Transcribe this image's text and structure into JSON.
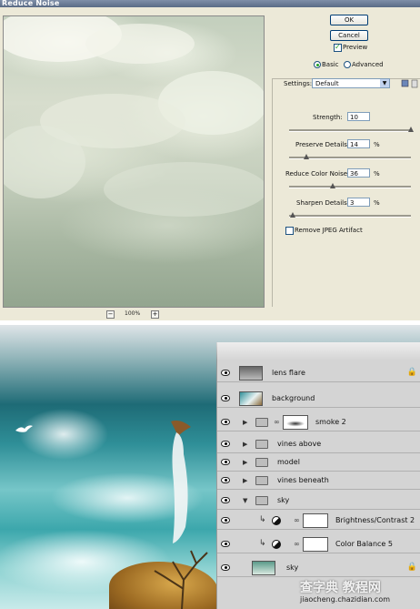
{
  "dialog": {
    "title": "Reduce Noise",
    "zoom": {
      "level": "100%",
      "minus": "−",
      "plus": "+"
    },
    "buttons": {
      "ok": "OK",
      "cancel": "Cancel"
    },
    "preview_checkbox": {
      "label": "Preview",
      "checked": true
    },
    "mode": {
      "basic": "Basic",
      "advanced": "Advanced",
      "selected": "Basic"
    },
    "settings": {
      "label": "Settings:",
      "value": "Default"
    },
    "fields": {
      "strength": {
        "label": "Strength:",
        "value": "10",
        "unit": "",
        "slider_fraction": 1.0
      },
      "preserve_details": {
        "label": "Preserve Details:",
        "value": "14",
        "unit": "%",
        "slider_fraction": 0.14
      },
      "reduce_color_noise": {
        "label": "Reduce Color Noise:",
        "value": "36",
        "unit": "%",
        "slider_fraction": 0.36
      },
      "sharpen_details": {
        "label": "Sharpen Details:",
        "value": "3",
        "unit": "%",
        "slider_fraction": 0.03
      }
    },
    "remove_jpeg": {
      "label": "Remove JPEG Artifact",
      "checked": false
    }
  },
  "layers": [
    {
      "name": "lens flare",
      "kind": "pixel",
      "visible": true
    },
    {
      "name": "background",
      "kind": "pixel",
      "visible": true
    },
    {
      "name": "smoke 2",
      "kind": "group-masked",
      "visible": true
    },
    {
      "name": "vines above",
      "kind": "group",
      "visible": true
    },
    {
      "name": "model",
      "kind": "group",
      "visible": true
    },
    {
      "name": "vines beneath",
      "kind": "group",
      "visible": true
    },
    {
      "name": "sky",
      "kind": "group-open",
      "visible": true
    },
    {
      "name": "Brightness/Contrast 2",
      "kind": "adjustment",
      "visible": true
    },
    {
      "name": "Color Balance 5",
      "kind": "adjustment",
      "visible": true
    },
    {
      "name": "sky",
      "kind": "pixel",
      "visible": true
    }
  ],
  "watermark": {
    "main": "查字典 教程网",
    "url": "jiaocheng.chazidian.com"
  },
  "colors": {
    "dialog_bg": "#ece9d8",
    "panel_bg": "#d4d4d4",
    "check_green": "#21a121"
  }
}
